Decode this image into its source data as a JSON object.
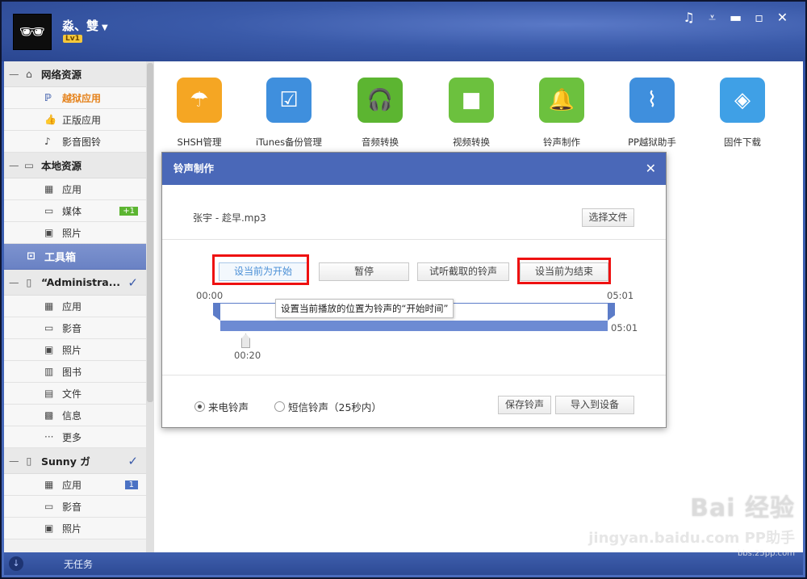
{
  "header": {
    "username": "淼、雙",
    "level": "Lv1",
    "window_controls": [
      "music-icon",
      "menu-icon",
      "minimize-icon",
      "maximize-icon",
      "close-icon"
    ]
  },
  "sidebar": {
    "network_group": "网络资源",
    "network_items": [
      {
        "label": "越狱应用",
        "icon": "jailbreak-icon",
        "active": true
      },
      {
        "label": "正版应用",
        "icon": "thumbs-up-icon"
      },
      {
        "label": "影音图铃",
        "icon": "music-icon"
      }
    ],
    "local_group": "本地资源",
    "local_items": [
      {
        "label": "应用",
        "icon": "grid-icon"
      },
      {
        "label": "媒体",
        "icon": "video-icon",
        "badge": "+1"
      },
      {
        "label": "照片",
        "icon": "image-icon"
      }
    ],
    "toolbox": "工具箱",
    "device1_group": "“Administra...",
    "device1_items": [
      {
        "label": "应用",
        "icon": "grid-icon"
      },
      {
        "label": "影音",
        "icon": "video-icon"
      },
      {
        "label": "照片",
        "icon": "image-icon"
      },
      {
        "label": "图书",
        "icon": "book-icon"
      },
      {
        "label": "文件",
        "icon": "file-icon"
      },
      {
        "label": "信息",
        "icon": "message-icon"
      },
      {
        "label": "更多",
        "icon": "more-icon"
      }
    ],
    "device2_group": "Sunny ガ",
    "device2_items": [
      {
        "label": "应用",
        "icon": "grid-icon",
        "badge": "1"
      },
      {
        "label": "影音",
        "icon": "video-icon"
      },
      {
        "label": "照片",
        "icon": "image-icon"
      }
    ]
  },
  "bottombar": {
    "task_status": "无任务"
  },
  "tools": [
    {
      "label": "SHSH管理",
      "color": "#f5a623",
      "icon": "umbrella-icon"
    },
    {
      "label": "iTunes备份管理",
      "color": "#3f8fdd",
      "icon": "backup-icon"
    },
    {
      "label": "音频转换",
      "color": "#5cb531",
      "icon": "headphones-icon"
    },
    {
      "label": "视频转换",
      "color": "#6cc13e",
      "icon": "camera-icon"
    },
    {
      "label": "铃声制作",
      "color": "#6cc13e",
      "icon": "bell-icon"
    },
    {
      "label": "PP越狱助手",
      "color": "#3f8fdd",
      "icon": "zipper-apple-icon"
    },
    {
      "label": "固件下载",
      "color": "#3fa0e6",
      "icon": "box-icon"
    }
  ],
  "dialog": {
    "title": "铃声制作",
    "file_name": "张宇 - 趁早.mp3",
    "choose_file": "选择文件",
    "set_start": "设当前为开始",
    "pause": "暂停",
    "listen": "试听截取的铃声",
    "set_end": "设当前为结束",
    "time_start": "00:00",
    "time_end_top": "05:01",
    "time_end_mid": "05:01",
    "time_current": "00:20",
    "tooltip": "设置当前播放的位置为铃声的“开始时间”",
    "ringtone_call": "来电铃声",
    "ringtone_sms": "短信铃声（25秒内）",
    "ringtone_selected": "来电铃声",
    "save": "保存铃声",
    "import": "导入到设备"
  },
  "watermark": {
    "line1": "Bai 经验",
    "line2": "jingyan.baidu.com  PP助手",
    "line3": "bbs.25pp.com"
  }
}
